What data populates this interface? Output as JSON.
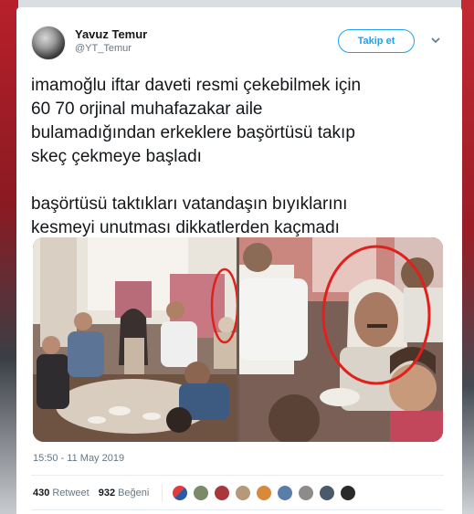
{
  "user": {
    "name": "Yavuz Temur",
    "handle": "@YT_Temur"
  },
  "header": {
    "follow_label": "Takip et"
  },
  "tweet": {
    "lines_p1": [
      "imamoğlu iftar daveti resmi çekebilmek için",
      "60 70 orjinal muhafazakar aile",
      "bulamadığından erkeklere başörtüsü takıp",
      "skeç çekmeye başladı"
    ],
    "lines_p2": [
      "başörtüsü taktıkları vatandaşın bıyıklarını",
      "kesmeyi unutması dikkatlerden kaçmadı"
    ],
    "timestamp": "15:50 - 11 May 2019"
  },
  "stats": {
    "retweets": "430",
    "retweets_label": "Retweet",
    "likes": "932",
    "likes_label": "Beğeni"
  },
  "colors": {
    "accent": "#1da1f2",
    "text": "#14171a",
    "muted": "#657786",
    "highlight_circle": "#e0201c"
  }
}
